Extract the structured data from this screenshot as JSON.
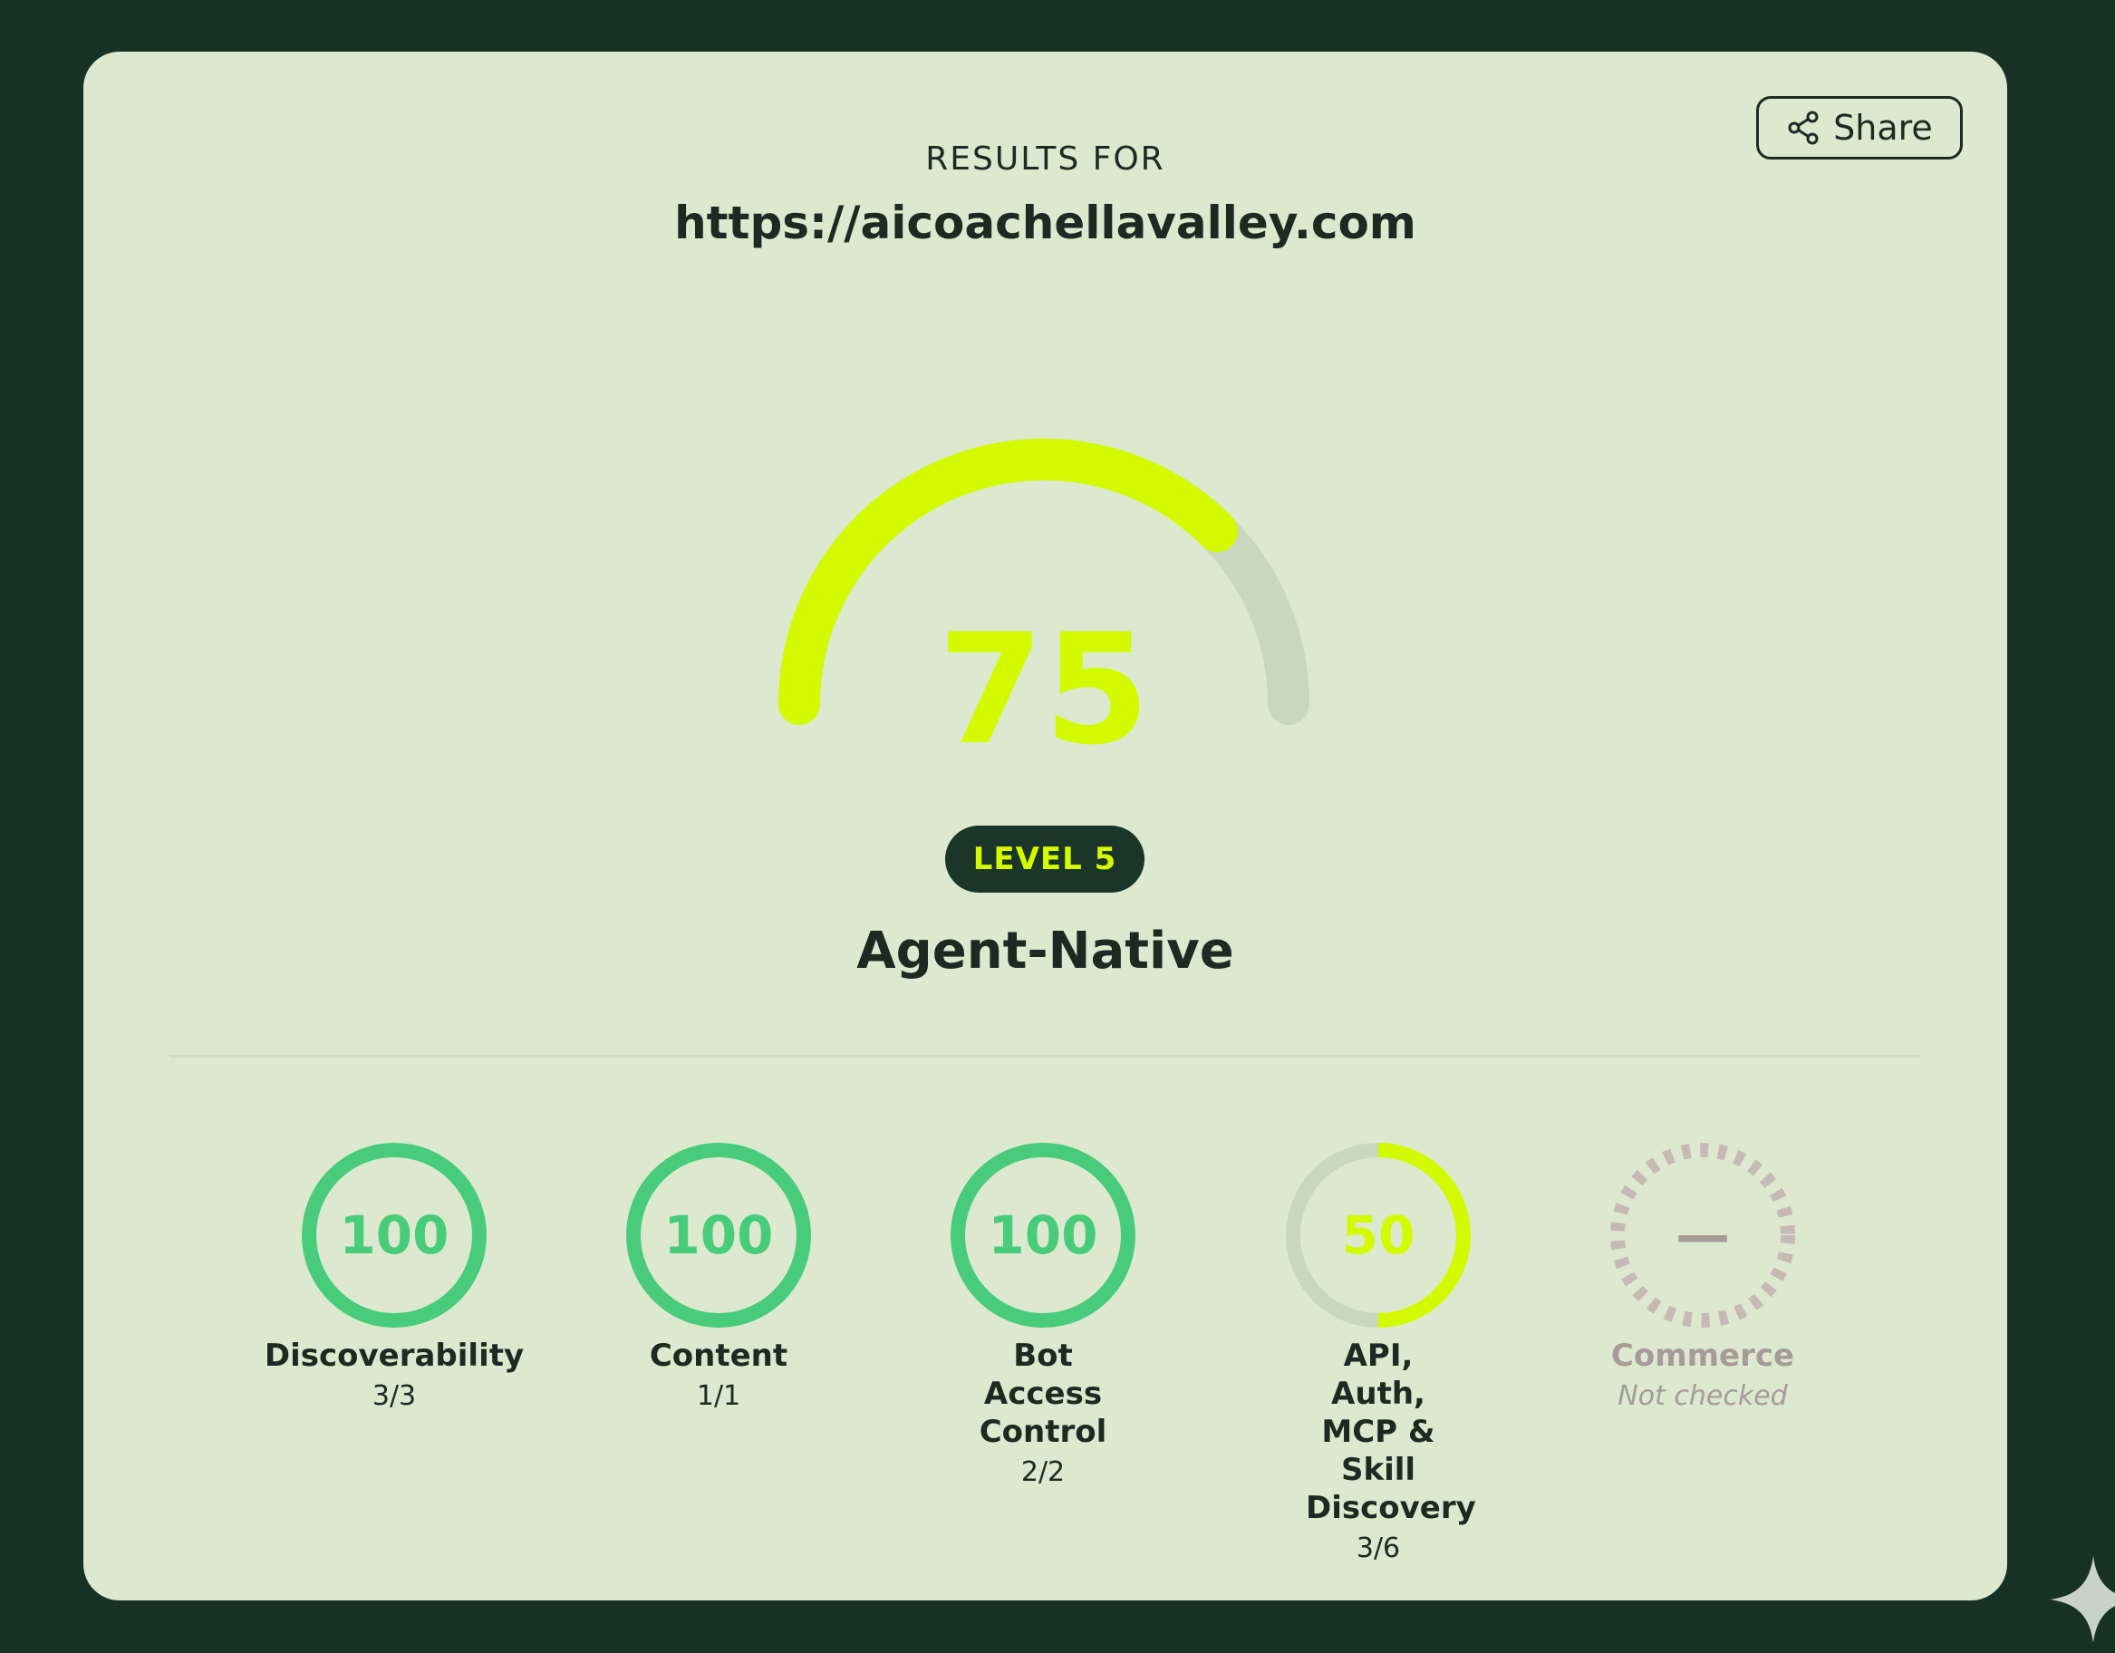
{
  "header": {
    "results_label": "RESULTS FOR",
    "url": "https://aicoachellavalley.com",
    "share_label": "Share"
  },
  "score": {
    "value": "75",
    "fraction": 0.75,
    "level_badge": "LEVEL 5",
    "level_name": "Agent-Native"
  },
  "categories": [
    {
      "name": "Discoverability",
      "score": "100",
      "fraction": 1.0,
      "detail": "3/3",
      "state": "pass"
    },
    {
      "name": "Content",
      "score": "100",
      "fraction": 1.0,
      "detail": "1/1",
      "state": "pass"
    },
    {
      "name": "Bot Access Control",
      "score": "100",
      "fraction": 1.0,
      "detail": "2/2",
      "state": "pass"
    },
    {
      "name": "API, Auth, MCP & Skill Discovery",
      "score": "50",
      "fraction": 0.5,
      "detail": "3/6",
      "state": "partial"
    },
    {
      "name": "Commerce",
      "score": "—",
      "fraction": 0,
      "detail": "Not checked",
      "state": "unchecked"
    }
  ],
  "colors": {
    "background": "#173126",
    "card": "#dce9cf",
    "accent": "#d4fa00",
    "pass": "#48cc7c",
    "track": "#c9d7bc",
    "unchecked": "#a69b98",
    "badge_bg": "#1a3628"
  },
  "icons": {
    "share": "share-icon",
    "sparkle": "sparkle-icon"
  }
}
